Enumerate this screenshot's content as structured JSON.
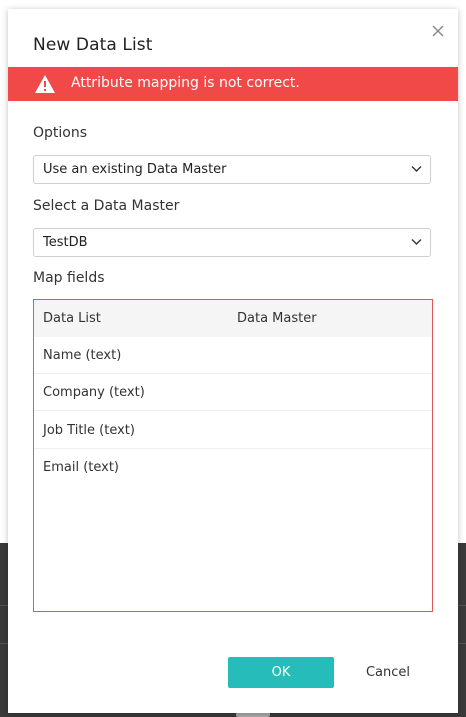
{
  "modal": {
    "title": "New Data List",
    "alert_text": "Attribute mapping is not correct."
  },
  "options": {
    "label": "Options",
    "selected": "Use an existing Data Master"
  },
  "data_master": {
    "label": "Select a Data Master",
    "selected": "TestDB"
  },
  "map_fields": {
    "label": "Map fields",
    "columns": [
      "Data List",
      "Data Master"
    ],
    "rows": [
      {
        "data_list": "Name (text)",
        "data_master": ""
      },
      {
        "data_list": "Company (text)",
        "data_master": ""
      },
      {
        "data_list": "Job Title (text)",
        "data_master": ""
      },
      {
        "data_list": "Email (text)",
        "data_master": ""
      }
    ]
  },
  "footer": {
    "ok_label": "OK",
    "cancel_label": "Cancel"
  },
  "colors": {
    "alert": "#f14848",
    "primary": "#26bcba",
    "error_border": "#e0575a"
  },
  "icons": {
    "close": "close-icon",
    "alert": "warning-icon",
    "dropdown": "chevron-down-icon"
  }
}
